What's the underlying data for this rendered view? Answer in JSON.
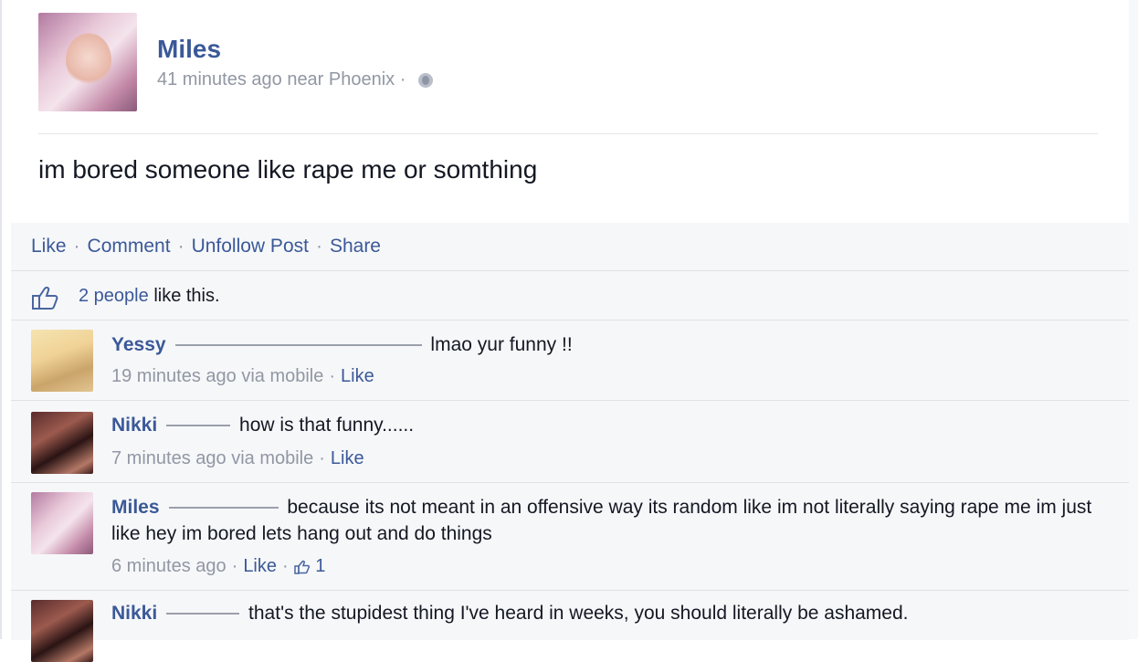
{
  "post": {
    "author": "Miles",
    "meta": "41 minutes ago near Phoenix ·",
    "text": "im bored someone like rape me or somthing"
  },
  "actions": {
    "like": "Like",
    "comment": "Comment",
    "unfollow": "Unfollow Post",
    "share": "Share"
  },
  "likes": {
    "count_link": "2 people",
    "suffix": "like this."
  },
  "comments": [
    {
      "name": "Yessy",
      "text": "lmao yur funny !!",
      "time": "19 minutes ago via mobile",
      "like": "Like"
    },
    {
      "name": "Nikki",
      "text": "how is that funny......",
      "time": "7 minutes ago via mobile",
      "like": "Like"
    },
    {
      "name": "Miles",
      "text": "because its not meant in an offensive way its random like im not literally saying rape me im just like hey im bored lets hang out and do things",
      "time": "6 minutes ago",
      "like": "Like",
      "like_count": "1"
    },
    {
      "name": "Nikki",
      "text": "that's the stupidest thing I've heard in weeks, you should literally be ashamed."
    }
  ]
}
